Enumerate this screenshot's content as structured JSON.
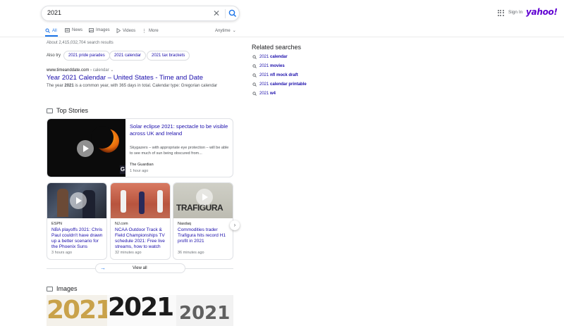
{
  "search": {
    "query": "2021"
  },
  "header": {
    "signin": "Sign In",
    "logo": "yahoo!"
  },
  "tabs": [
    {
      "label": "All",
      "icon": "search-icon"
    },
    {
      "label": "News",
      "icon": "news-icon"
    },
    {
      "label": "Images",
      "icon": "image-icon"
    },
    {
      "label": "Videos",
      "icon": "video-icon"
    },
    {
      "label": "More",
      "icon": "more-icon"
    }
  ],
  "filter": {
    "label": "Anytime"
  },
  "stats": "About 2,415,032,704 search results",
  "also_try": {
    "label": "Also try",
    "chips": [
      "2021 pride parades",
      "2021 calendar",
      "2021 tax brackets"
    ]
  },
  "result": {
    "domain": "www.timeanddate.com",
    "path": " › calendar",
    "title": "Year 2021 Calendar – United States - Time and Date",
    "snippet_pre": "The year ",
    "snippet_bold": "2021",
    "snippet_post": " is a common year, with 365 days in total. Calendar type: Gregorian calendar"
  },
  "related": {
    "heading": "Related searches",
    "items": [
      {
        "prefix": "2021 ",
        "bold": "calendar"
      },
      {
        "prefix": "2021 ",
        "bold": "movies"
      },
      {
        "prefix": "2021 ",
        "bold": "nfl mock draft"
      },
      {
        "prefix": "2021 ",
        "bold": "calendar printable"
      },
      {
        "prefix": "2021 ",
        "bold": "w4"
      }
    ]
  },
  "top_stories": {
    "heading": "Top Stories",
    "featured": {
      "title": "Solar eclipse 2021: spectacle to be visible across UK and Ireland",
      "snippet": "Skygazers – with appropriate eye protection – will be able to see much of sun being obscured from...",
      "source": "The Guardian",
      "time": "1 hour ago"
    },
    "cards": [
      {
        "source": "ESPN",
        "title": "NBA playoffs 2021: Chris Paul couldn't have drawn up a better scenario for the Phoenix Suns",
        "time": "3 hours ago"
      },
      {
        "source": "NJ.com",
        "title": "NCAA Outdoor Track & Field Championships TV schedule 2021: Free live streams, how to watch",
        "time": "32 minutes ago"
      },
      {
        "source": "Nasdaq",
        "title": "Commodities trader Trafigura hits record H1 profit in 2021",
        "time": "36 minutes ago"
      }
    ],
    "view_all": "View all",
    "thumb_text": "TRAFIGURA"
  },
  "images": {
    "heading": "Images",
    "tiles": [
      "2021",
      "2021",
      "2021"
    ]
  }
}
